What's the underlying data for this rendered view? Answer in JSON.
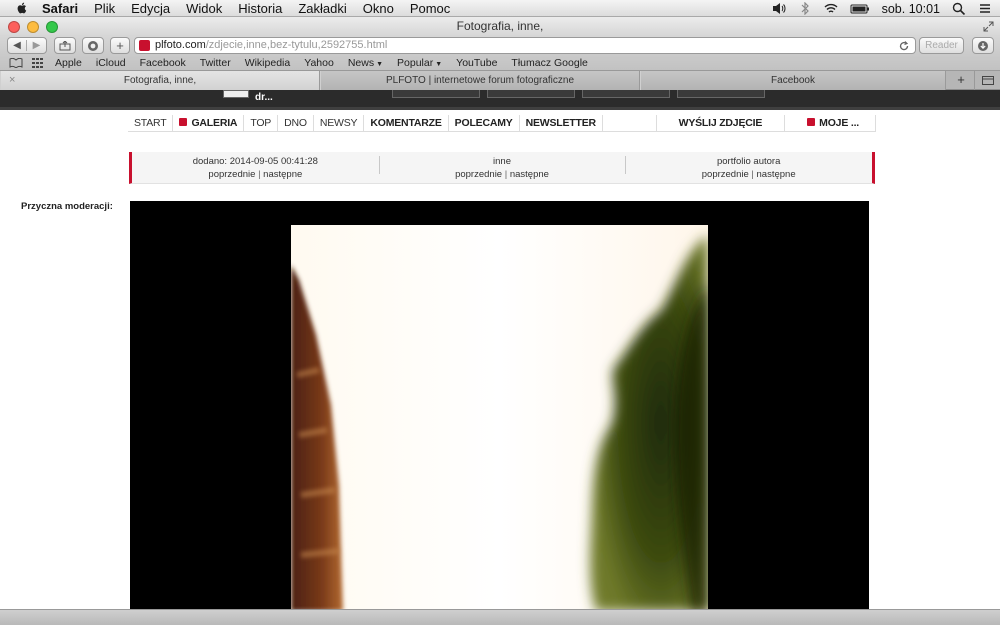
{
  "menubar": {
    "app": "Safari",
    "items": [
      "Plik",
      "Edycja",
      "Widok",
      "Historia",
      "Zakładki",
      "Okno",
      "Pomoc"
    ],
    "clock": "sob. 10:01"
  },
  "window": {
    "title": "Fotografia, inne,"
  },
  "toolbar": {
    "url_host": "plfoto.com",
    "url_path": "/zdjecie,inne,bez-tytulu,2592755.html",
    "reader_label": "Reader"
  },
  "bookmarks": [
    "Apple",
    "iCloud",
    "Facebook",
    "Twitter",
    "Wikipedia",
    "Yahoo",
    "News",
    "Popular",
    "YouTube",
    "Tłumacz Google"
  ],
  "tabs": [
    "Fotografia, inne,",
    "PLFOTO | internetowe forum fotograficzne",
    "Facebook"
  ],
  "site": {
    "strip_text": "dr...",
    "nav": [
      "START",
      "GALERIA",
      "TOP",
      "DNO",
      "NEWSY",
      "KOMENTARZE",
      "POLECAMY",
      "NEWSLETTER",
      "WYŚLIJ ZDJĘCIE",
      "MOJE ..."
    ],
    "info": {
      "added": "dodano: 2014-09-05 00:41:28",
      "category": "inne",
      "portfolio": "portfolio autora",
      "prev": "poprzednie",
      "sep": "|",
      "next": "następne"
    },
    "moderation_label": "Przyczna moderacji:"
  },
  "colors": {
    "accent": "#c8102e",
    "dark_strip": "#2b2b2b"
  }
}
